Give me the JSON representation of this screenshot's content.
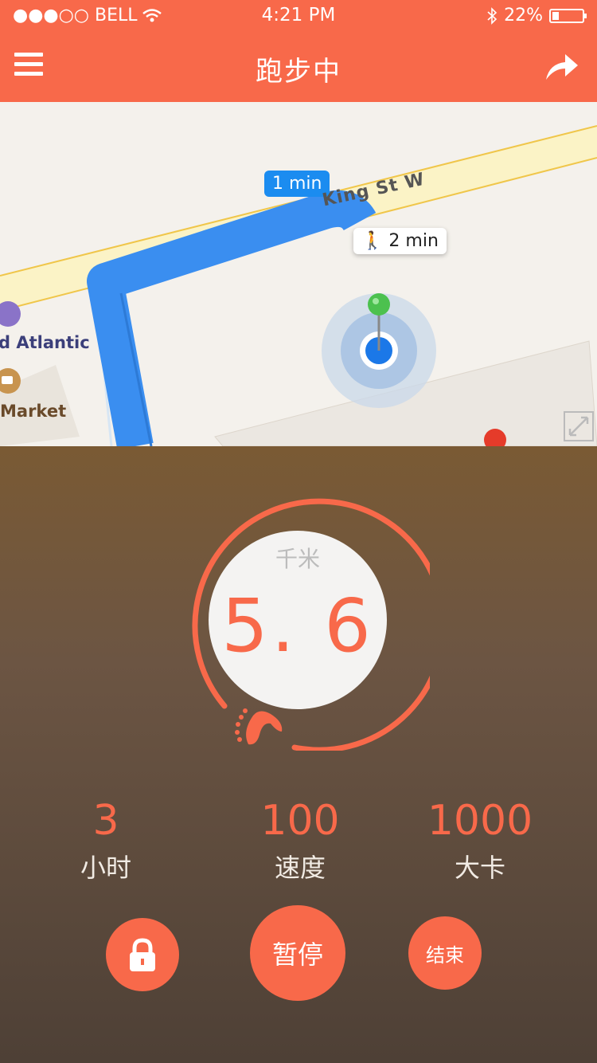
{
  "status_bar": {
    "carrier": "●●●○○ BELL",
    "time": "4:21 PM",
    "battery": "22%"
  },
  "nav": {
    "title": "跑步中",
    "menu_icon": "hamburger-menu-icon",
    "share_icon": "share-arrow-icon"
  },
  "map": {
    "eta_walk": "1 min",
    "eta_run": "2 min",
    "street": "King St W",
    "poi_1": "d Atlantic",
    "poi_2": "Market",
    "route_color": "#3a8ef0"
  },
  "distance": {
    "unit": "千米",
    "value": "5. 6"
  },
  "stats": {
    "time_value": "3",
    "time_label": "小时",
    "speed_value": "100",
    "speed_label": "速度",
    "calories_value": "1000",
    "calories_label": "大卡"
  },
  "controls": {
    "pause_label": "暂停",
    "end_label": "结束",
    "lock_icon": "lock-icon"
  },
  "colors": {
    "accent": "#f8694a"
  }
}
